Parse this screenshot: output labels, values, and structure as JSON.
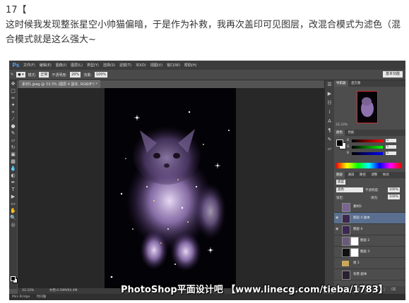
{
  "caption": {
    "step": "17【",
    "body": "这时候我发现整张星空小帅猫偏暗，于是作为补救，我再次盖印可见图层，改混合模式为滤色（混合模式就是这么强大~"
  },
  "app": {
    "logo": "Ps",
    "menu": [
      "文件(F)",
      "编辑(E)",
      "图像(I)",
      "图层(L)",
      "类型(Y)",
      "选择(S)",
      "滤镜(T)",
      "3D(D)",
      "视图(V)",
      "窗口(W)",
      "帮助(H)"
    ],
    "options": {
      "mode_label": "模式:",
      "mode_value": "正常",
      "opacity_label": "不透明度:",
      "opacity_value": "20%",
      "flow_label": "流量:",
      "flow_value": "100%"
    },
    "workspace": "基本功能",
    "document_tab": "素材1.jpeg @ 33.3% (图层 4 副本, RGB/8*) *",
    "status": {
      "zoom": "33.33%",
      "doc_info": "文档:4.59M/94.4M"
    },
    "mini_bridge": {
      "tabs": [
        "Mini Bridge",
        "时间轴"
      ]
    },
    "panels": {
      "navigator_tabs": [
        "导航器",
        "直方图"
      ],
      "navigator_zoom": "33.33%",
      "color_tabs": [
        "颜色",
        "色板"
      ],
      "color_values": {
        "R": "5",
        "G": "5",
        "B": "5"
      },
      "layers_tabs": [
        "图层",
        "通道",
        "路径",
        "调整",
        "样式"
      ],
      "filter_label": "类型",
      "blend_mode": "滤色",
      "opacity_label": "不透明度:",
      "opacity_value": "100%",
      "lock_label": "锁定:",
      "fill_label": "填充:",
      "fill_value": "100%",
      "layers": [
        {
          "name": "素材2",
          "visible": false,
          "selected": false,
          "mask": false
        },
        {
          "name": "图层 4 副本",
          "visible": true,
          "selected": true,
          "mask": false
        },
        {
          "name": "图层 4",
          "visible": true,
          "selected": false,
          "mask": false
        },
        {
          "name": "图层 2",
          "visible": false,
          "selected": false,
          "mask": true
        },
        {
          "name": "图层 3",
          "visible": false,
          "selected": false,
          "mask": true
        },
        {
          "name": "组 1",
          "visible": false,
          "selected": false,
          "mask": false
        },
        {
          "name": "背景 副本",
          "visible": false,
          "selected": false,
          "mask": false
        }
      ]
    }
  },
  "watermark": "PhotoShop平面设计吧 【www.linecg.com/tieba/1783】",
  "colors": {
    "ui_dark": "#535353",
    "selected_layer": "#5a6f90",
    "nebula_purple": "#b08fd8"
  }
}
